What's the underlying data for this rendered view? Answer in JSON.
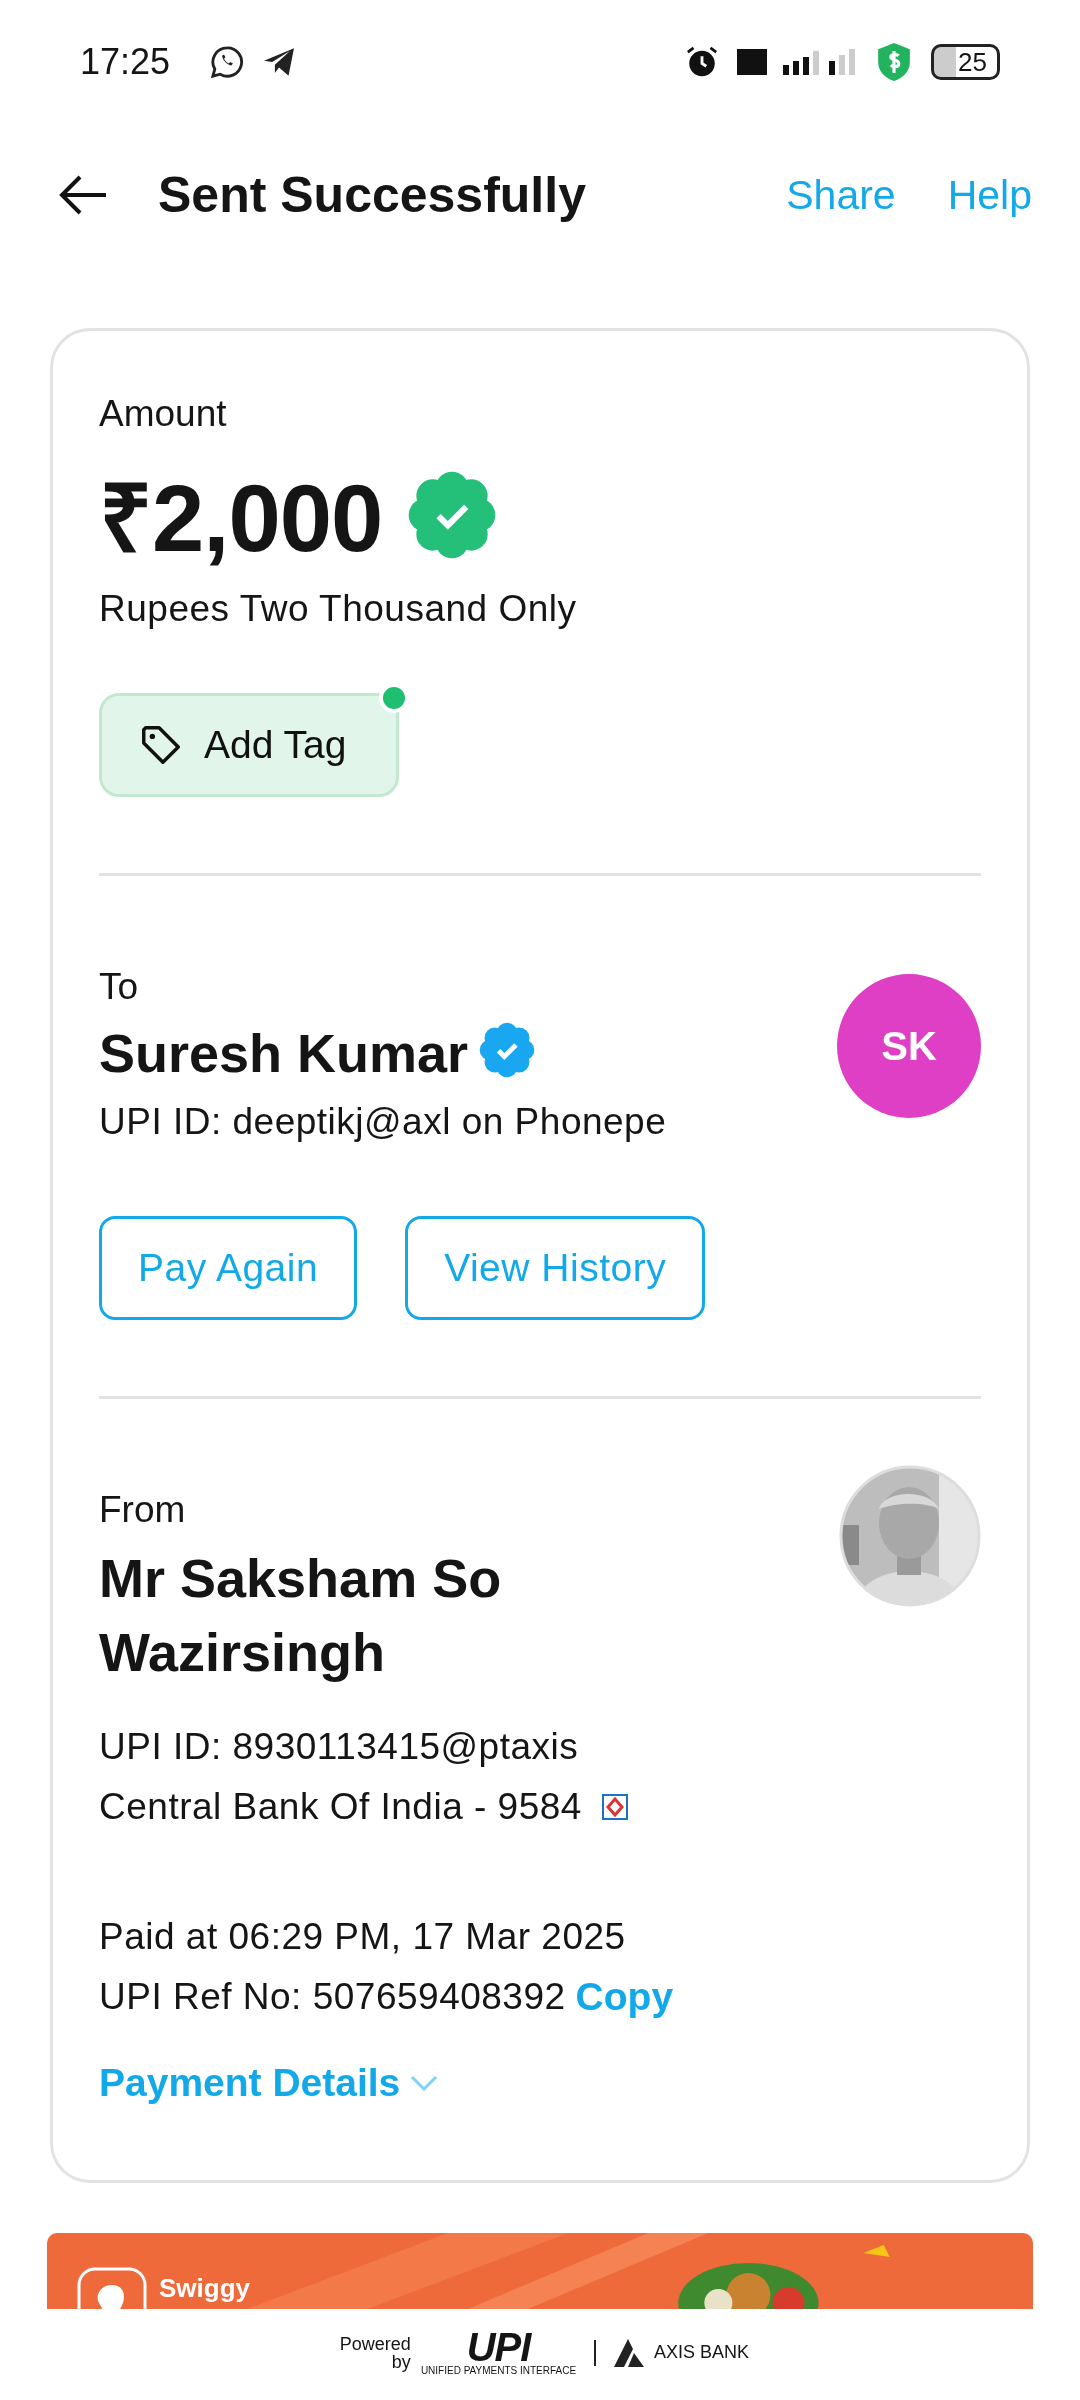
{
  "status_bar": {
    "time": "17:25",
    "battery": "25"
  },
  "header": {
    "title": "Sent Successfully",
    "actions": [
      "Share",
      "Help"
    ]
  },
  "amount": {
    "label": "Amount",
    "value": "₹2,000",
    "verified": true,
    "words": "Rupees Two Thousand Only",
    "tag_button": {
      "label": "Add Tag",
      "new": true
    }
  },
  "to": {
    "label": "To",
    "name": "Suresh Kumar",
    "verified": true,
    "upi_id": "UPI ID: deeptikj@axl on Phonepe",
    "initials": "SK",
    "buttons": [
      "Pay Again",
      "View History"
    ]
  },
  "from": {
    "label": "From",
    "name": "Mr Saksham So Wazirsingh",
    "upi_id": "UPI ID: 8930113415@ptaxis",
    "bank": "Central Bank Of India - 9584",
    "paid_at": "Paid at 06:29 PM, 17 Mar 2025",
    "ref": "UPI Ref No: 507659408392",
    "copy": "Copy"
  },
  "payment_details": {
    "label": "Payment Details",
    "expanded": false
  },
  "banner": {
    "brand": "Swiggy"
  },
  "footer": {
    "powered_by": "Powered by",
    "upi": "UPI",
    "upi_sub": "UNIFIED PAYMENTS INTERFACE",
    "bank": "AXIS BANK"
  }
}
